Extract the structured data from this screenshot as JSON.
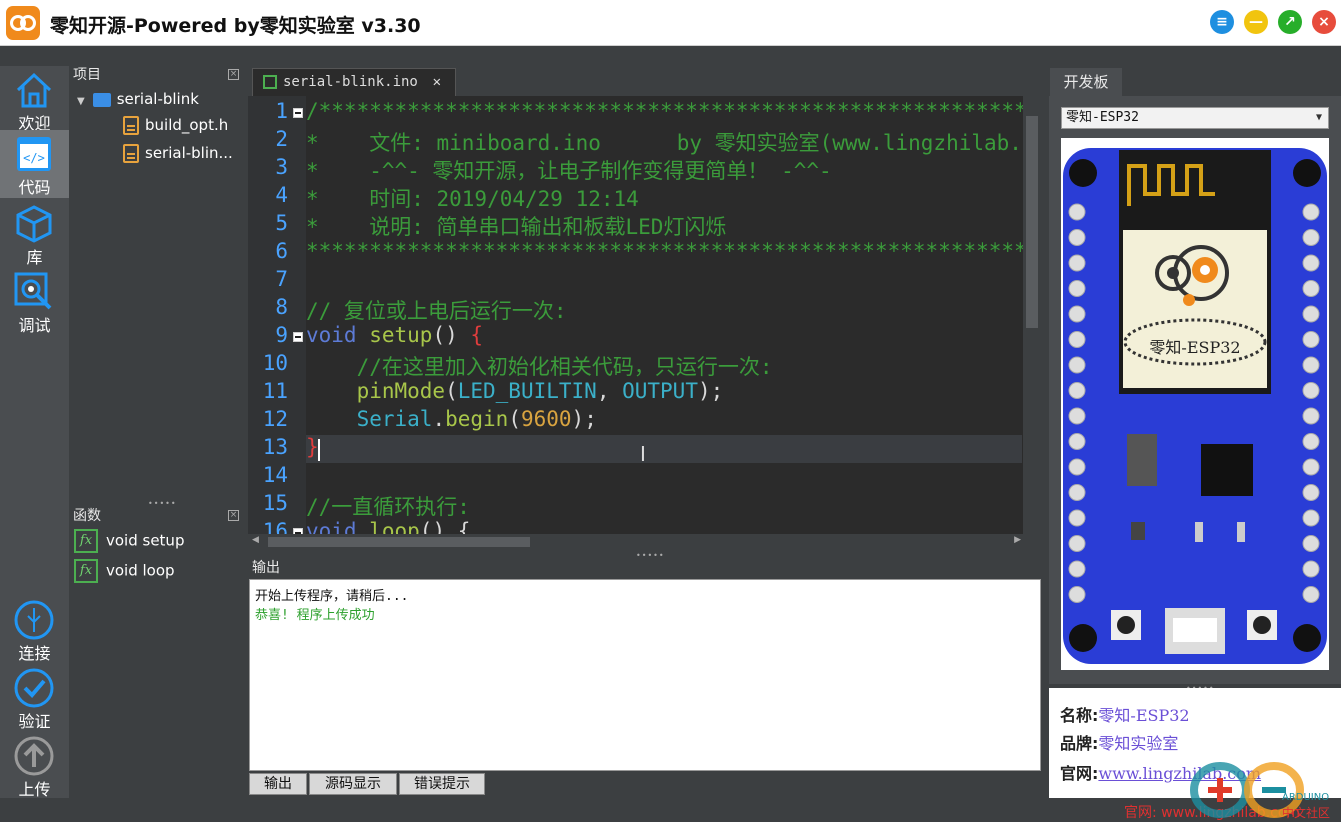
{
  "window": {
    "title": "零知开源-Powered by零知实验室 v3.30",
    "buttons": {
      "menu": "≡",
      "minimize": "—",
      "maximize": "↗",
      "close": "×"
    }
  },
  "nav": [
    {
      "label": "欢迎",
      "icon": "home-icon"
    },
    {
      "label": "代码",
      "icon": "code-icon",
      "active": true
    },
    {
      "label": "库",
      "icon": "cube-icon"
    },
    {
      "label": "调试",
      "icon": "debug-icon"
    },
    {
      "label": "连接",
      "icon": "usb-icon"
    },
    {
      "label": "验证",
      "icon": "check-icon"
    },
    {
      "label": "上传",
      "icon": "upload-icon"
    }
  ],
  "project": {
    "title": "项目",
    "root": "serial-blink",
    "files": [
      "build_opt.h",
      "serial-blin..."
    ]
  },
  "functions": {
    "title": "函数",
    "items": [
      "void setup",
      "void loop"
    ]
  },
  "editor": {
    "tab": "serial-blink.ino",
    "line_numbers": [
      "1",
      "2",
      "3",
      "4",
      "5",
      "6",
      "7",
      "8",
      "9",
      "10",
      "11",
      "12",
      "13",
      "14",
      "15",
      "16"
    ],
    "lines": {
      "l1": "/*****************************************************************",
      "l2": "*    文件: miniboard.ino      by 零知实验室(www.lingzhilab.com)",
      "l3": "*    -^^- 零知开源，让电子制作变得更简单！ -^^-",
      "l4": "*    时间: 2019/04/29 12:14",
      "l5": "*    说明: 简单串口输出和板载LED灯闪烁",
      "l6": "*****************************************************************",
      "l8": "// 复位或上电后运行一次:",
      "l9_kw": "void",
      "l9_fn": " setup",
      "l9_rest": "() ",
      "l9_br": "{",
      "l10": "    //在这里加入初始化相关代码，只运行一次:",
      "l11_fn": "    pinMode",
      "l11_p1": "(",
      "l11_c1": "LED_BUILTIN",
      "l11_p2": ", ",
      "l11_c2": "OUTPUT",
      "l11_p3": ");",
      "l12_c": "    Serial",
      "l12_p1": ".",
      "l12_fn": "begin",
      "l12_p2": "(",
      "l12_num": "9600",
      "l12_p3": ");",
      "l13": "}",
      "l15": "//一直循环执行:",
      "l16_kw": "void",
      "l16_fn": " loop",
      "l16_rest": "() {"
    }
  },
  "output": {
    "title": "输出",
    "lines": [
      "开始上传程序，请稍后...",
      "恭喜! 程序上传成功"
    ],
    "tabs": [
      "输出",
      "源码显示",
      "错误提示"
    ]
  },
  "board": {
    "tab": "开发板",
    "selected": "零知-ESP32",
    "chip_label": "零知-ESP32",
    "name_label": "名称:",
    "name": "零知-ESP32",
    "brand_label": "品牌:",
    "brand": "零知实验室",
    "site_label": "官网:",
    "site": "www.lingzhilab.com"
  },
  "status": {
    "site": "官网: www.lingzhilab.com"
  },
  "watermark": {
    "brand": "ARDUINO",
    "community": "中文社区"
  },
  "colors": {
    "accent": "#2196f3",
    "comment": "#3b9c3b",
    "keyword": "#5d7bd6",
    "line_number": "#4aa3ff",
    "board_blue": "#2a3dd6"
  }
}
